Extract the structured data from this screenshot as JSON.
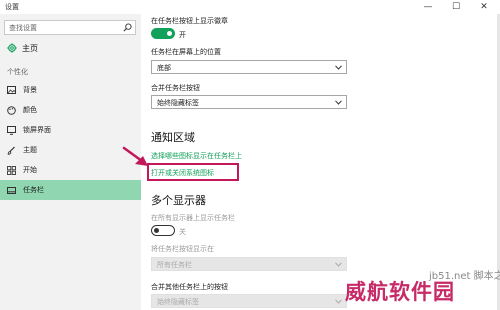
{
  "window": {
    "title": "设置",
    "controls": {
      "minimize": "—",
      "maximize": "☐",
      "close": "✕"
    }
  },
  "sidebar": {
    "search_placeholder": "查找设置",
    "home_label": "主页",
    "section_label": "个性化",
    "items": [
      {
        "label": "背景",
        "icon": "picture-icon"
      },
      {
        "label": "颜色",
        "icon": "palette-icon"
      },
      {
        "label": "锁屏界面",
        "icon": "monitor-icon"
      },
      {
        "label": "主题",
        "icon": "brush-icon"
      },
      {
        "label": "开始",
        "icon": "start-grid-icon"
      },
      {
        "label": "任务栏",
        "icon": "taskbar-icon",
        "active": true
      }
    ]
  },
  "main": {
    "badges": {
      "label": "在任务栏按钮上显示徽章",
      "toggle_state": "开",
      "on": true
    },
    "position": {
      "label": "任务栏在屏幕上的位置",
      "value": "底部"
    },
    "combine": {
      "label": "合并任务栏按钮",
      "value": "始终隐藏标签"
    },
    "notification_area": {
      "heading": "通知区域",
      "link1": "选择哪些图标显示在任务栏上",
      "link2": "打开或关闭系统图标"
    },
    "multi_display": {
      "heading": "多个显示器",
      "show_all_label": "在所有显示器上显示任务栏",
      "toggle_state": "关",
      "on": false,
      "show_buttons_label": "将任务栏按钮显示在",
      "show_buttons_value": "所有任务栏",
      "combine_other_label": "合并其他任务栏上的按钮",
      "combine_other_value": "始终隐藏标签"
    }
  },
  "watermark": {
    "main": "威航软件园",
    "small": "jb51.net 脚本之家"
  },
  "colors": {
    "accent": "#12a05a",
    "active_nav": "#8fd6b1",
    "highlight": "#c2185b"
  }
}
